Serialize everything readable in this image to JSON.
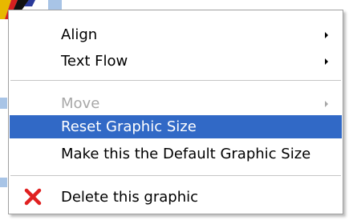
{
  "menu": {
    "items": [
      {
        "label": "Align",
        "has_submenu": true,
        "enabled": true
      },
      {
        "label": "Text Flow",
        "has_submenu": true,
        "enabled": true
      },
      {
        "label": "Move",
        "has_submenu": true,
        "enabled": false
      },
      {
        "label": "Reset Graphic Size",
        "has_submenu": false,
        "enabled": true,
        "highlighted": true
      },
      {
        "label": "Make this the Default Graphic Size",
        "has_submenu": false,
        "enabled": true
      },
      {
        "label": "Delete this graphic",
        "has_submenu": false,
        "enabled": true,
        "icon": "delete-x-icon"
      }
    ]
  },
  "colors": {
    "highlight": "#3169c6",
    "disabled_text": "#a7a7a7",
    "delete_icon": "#e02020",
    "background_square": "#a8c4e6"
  }
}
